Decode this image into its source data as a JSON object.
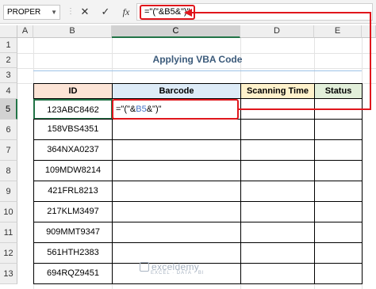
{
  "formula_bar": {
    "name_box": "PROPER",
    "cancel_icon": "✕",
    "enter_icon": "✓",
    "function_icon": "fx",
    "formula": "=\"(\"&B5&\")\""
  },
  "columns": [
    "A",
    "B",
    "C",
    "D",
    "E"
  ],
  "rows": [
    "1",
    "2",
    "3",
    "4",
    "5",
    "6",
    "7",
    "8",
    "9",
    "10",
    "11",
    "12",
    "13"
  ],
  "sheet": {
    "title": "Applying VBA Code",
    "headers": {
      "id": "ID",
      "barcode": "Barcode",
      "scanning_time": "Scanning Time",
      "status": "Status"
    },
    "header_colors": {
      "id": "#fce4d6",
      "barcode": "#ddebf7",
      "scanning_time": "#fff2cc",
      "status": "#e2efda"
    },
    "ids": [
      "123ABC8462",
      "158VBS4351",
      "364NXA0237",
      "109MDW8214",
      "421FRL8213",
      "217KLM3497",
      "909MMT9347",
      "561HTH2383",
      "694RQZ9451"
    ],
    "editing_cell": {
      "prefix": "=\"(\"&",
      "ref": "B5",
      "suffix": "&\")\""
    }
  },
  "watermark": {
    "brand": "exceldemy",
    "tagline": "EXCEL · DATA · BI"
  }
}
